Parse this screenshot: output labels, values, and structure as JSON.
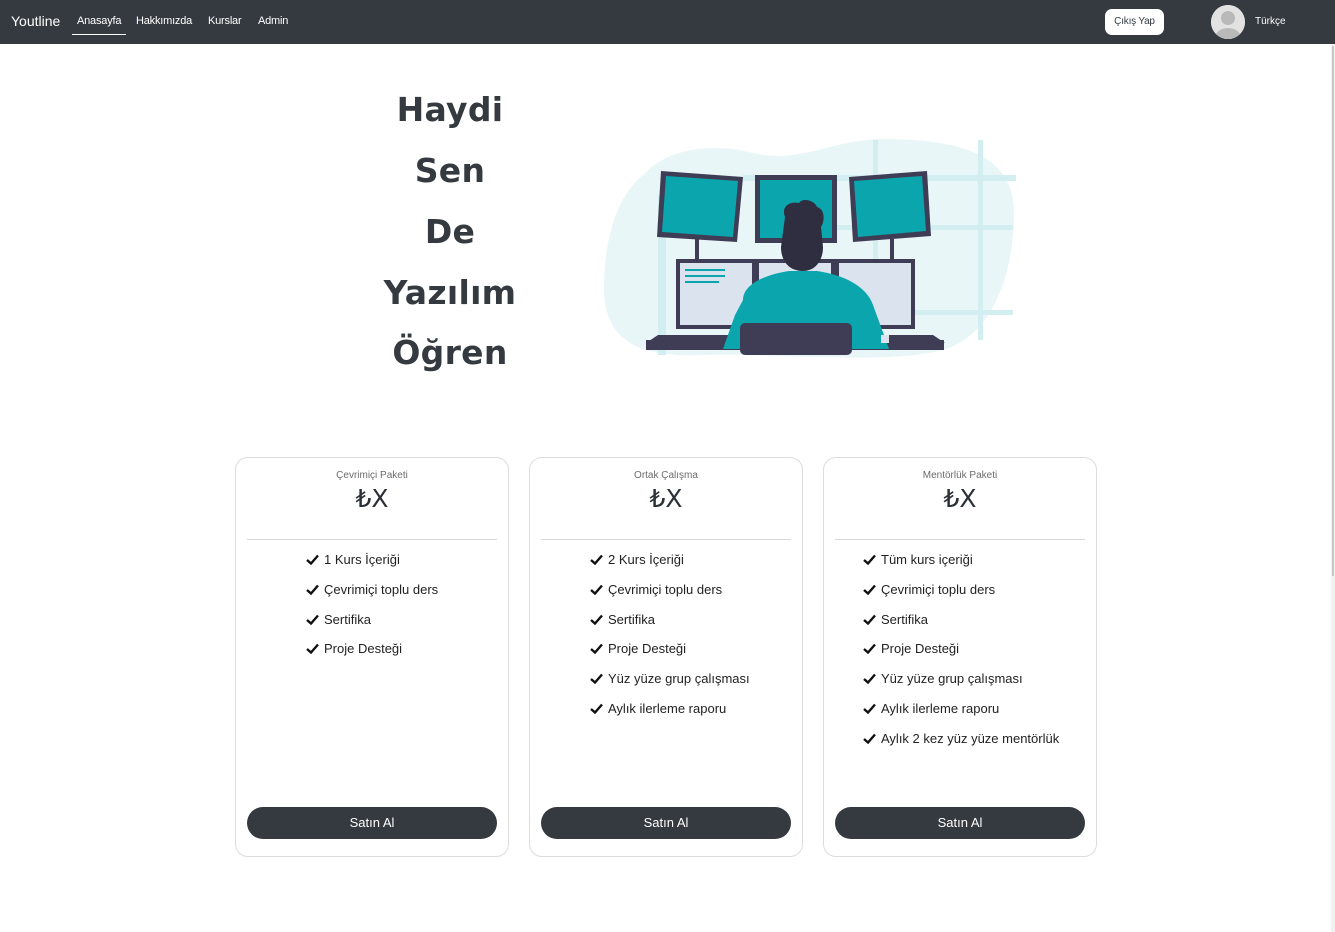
{
  "navbar": {
    "brand": "Youtline",
    "links": [
      {
        "label": "Anasayfa",
        "active": true
      },
      {
        "label": "Hakkımızda",
        "active": false
      },
      {
        "label": "Kurslar",
        "active": false
      },
      {
        "label": "Admin",
        "active": false
      }
    ],
    "logout_label": "Çıkış Yap",
    "avatar_icon": "user-avatar-icon",
    "language": "Türkçe",
    "background_color": "#343a40"
  },
  "hero": {
    "words": [
      "Haydi",
      "Sen",
      "De",
      "Yazılım",
      "Öğren"
    ],
    "illustration": "developer-at-monitors-illustration",
    "accent_color": "#0aa5ad"
  },
  "pricing": {
    "cards": [
      {
        "name": "Çevrimiçi Paketi",
        "price": "₺X",
        "features": [
          "1 Kurs İçeriği",
          "Çevrimiçi toplu ders",
          "Sertifika",
          "Proje Desteği"
        ],
        "button": "Satın Al"
      },
      {
        "name": "Ortak Çalışma",
        "price": "₺X",
        "features": [
          "2 Kurs İçeriği",
          "Çevrimiçi toplu ders",
          "Sertifika",
          "Proje Desteği",
          "Yüz yüze grup çalışması",
          "Aylık ilerleme raporu"
        ],
        "button": "Satın Al"
      },
      {
        "name": "Mentörlük Paketi",
        "price": "₺X",
        "features": [
          "Tüm kurs içeriği",
          "Çevrimiçi toplu ders",
          "Sertifika",
          "Proje Desteği",
          "Yüz yüze grup çalışması",
          "Aylık ilerleme raporu",
          "Aylık 2 kez yüz yüze mentörlük"
        ],
        "button": "Satın Al"
      }
    ],
    "feature_icon": "check-icon"
  }
}
